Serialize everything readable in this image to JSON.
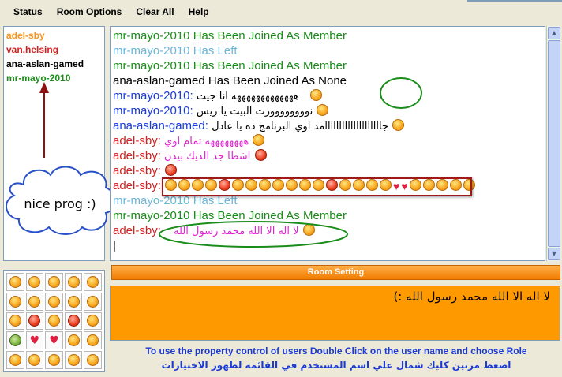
{
  "menu": {
    "items": [
      "Status",
      "Room Options",
      "Clear All",
      "Help"
    ]
  },
  "users": [
    {
      "name": "adel-sby",
      "color": "#f7931e"
    },
    {
      "name": "van,helsing",
      "color": "#d42020"
    },
    {
      "name": "ana-aslan-gamed",
      "color": "#000000"
    },
    {
      "name": "mr-mayo-2010",
      "color": "#1a8c1a"
    }
  ],
  "annotation": {
    "cloud_text": "nice prog :)"
  },
  "chat": {
    "lines": [
      {
        "text": "mr-mayo-2010 Has Been Joined As Member"
      },
      {
        "text": "mr-mayo-2010 Has Left"
      },
      {
        "text": "mr-mayo-2010 Has Been Joined As Member"
      },
      {
        "text": "ana-aslan-gamed Has Been Joined As None"
      },
      {
        "user": "mr-mayo-2010:",
        "msg": "هههههههههههههه انا جيت"
      },
      {
        "user": "mr-mayo-2010:",
        "msg": "نوووووووورت البيت يا ريس"
      },
      {
        "user": "ana-aslan-gamed:",
        "msg": "جاااااااااااااااااااامد اوي البرنامج ده يا عادل"
      },
      {
        "user": "adel-sby:",
        "msg": "ههههههههه تمام اوي"
      },
      {
        "user": "adel-sby:",
        "msg": "اشطا جد الديك بيدن"
      },
      {
        "user": "adel-sby:",
        "msg": ""
      },
      {
        "user": "adel-sby:",
        "msg": ""
      },
      {
        "text": "mr-mayo-2010 Has Left"
      },
      {
        "text": "mr-mayo-2010 Has Been Joined As Member"
      },
      {
        "user": "adel-sby:",
        "msg": "لا اله الا الله محمد رسول الله"
      }
    ]
  },
  "room_setting": {
    "label": "Room Setting"
  },
  "input": {
    "value": "لا اله الا الله محمد رسول الله :)"
  },
  "info": {
    "line1": "To use the property control of users Double Click on the user name and choose Role",
    "line2": "اضغط مرتين كليك شمال علي اسم المستخدم في القائمة لظهور الاختيارات"
  },
  "icons": {
    "emoticon": "smiley-face-icon",
    "heart": "heart-icon"
  }
}
